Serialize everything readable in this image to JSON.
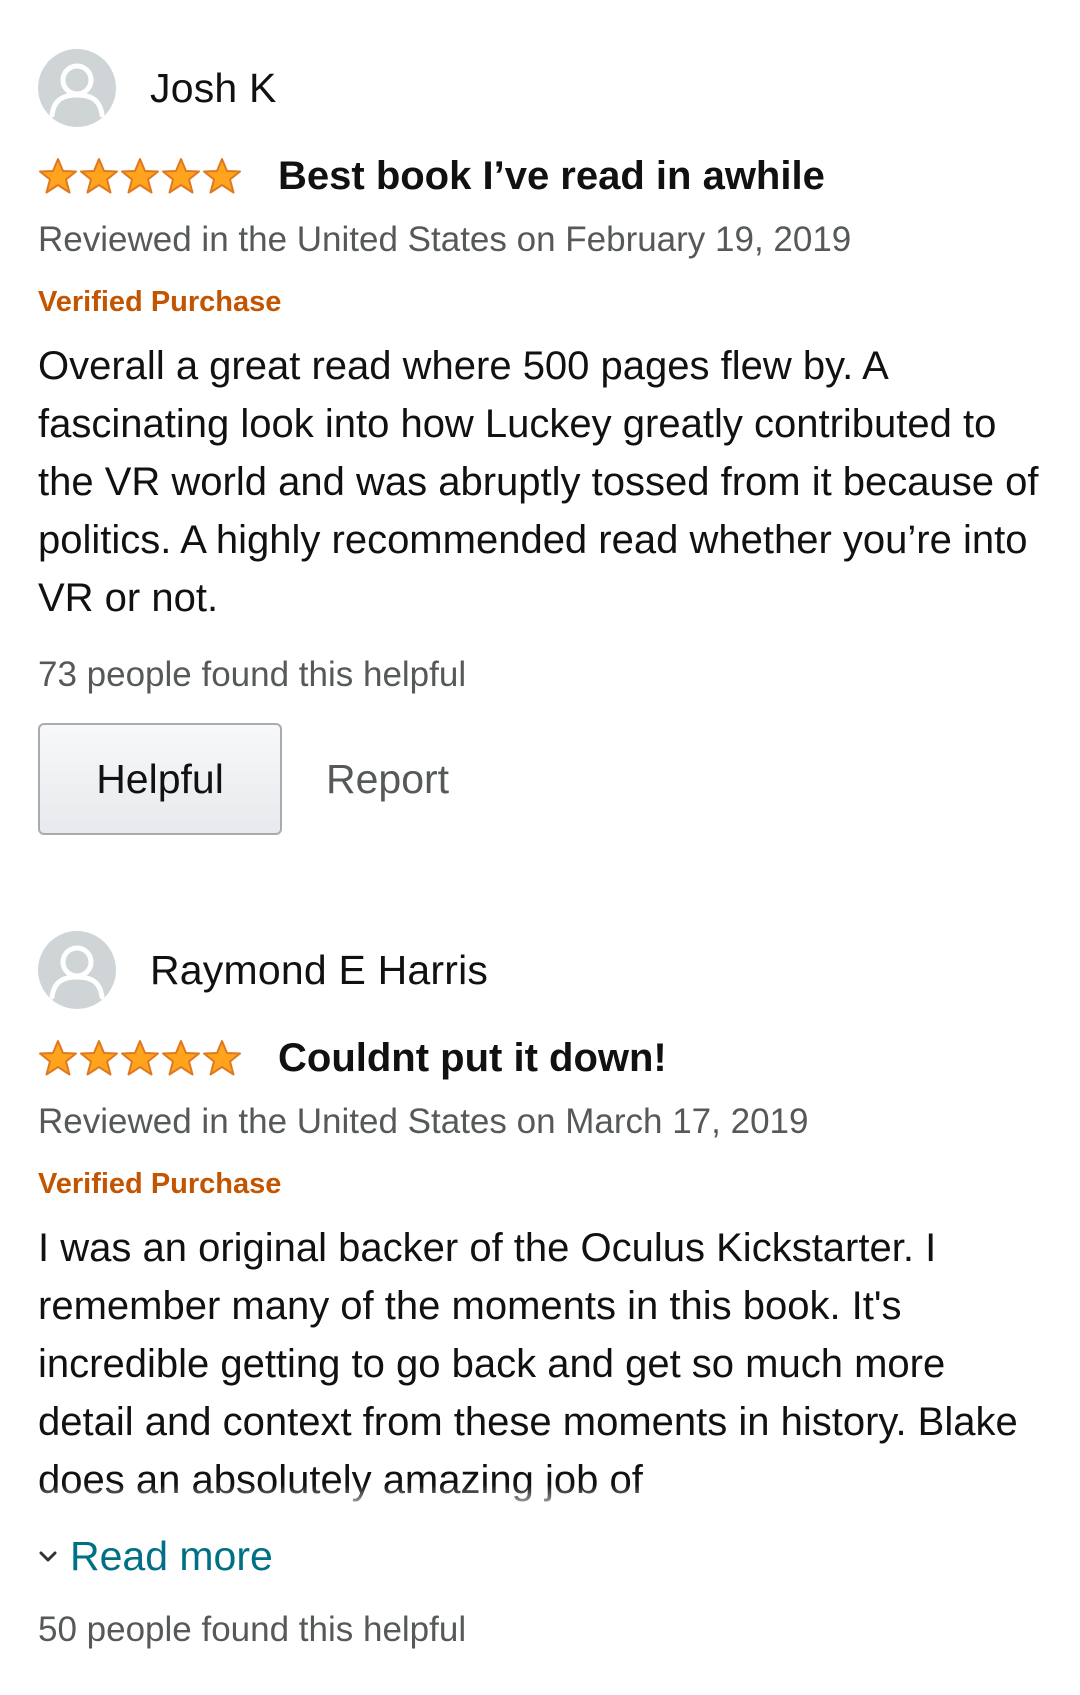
{
  "reviews": [
    {
      "reviewer": "Josh K",
      "rating": 5,
      "title": "Best book I’ve read in awhile",
      "date": "Reviewed in the United States on February 19, 2019",
      "verified": "Verified Purchase",
      "body": "Overall a great read where 500 pages flew by. A fascinating look into how Luckey greatly contributed to the VR world and was abruptly tossed from it because of politics. A highly recommended read whether you’re into VR or not.",
      "helpful_count": "73 people found this helpful",
      "helpful_label": "Helpful",
      "report_label": "Report"
    },
    {
      "reviewer": "Raymond E Harris",
      "rating": 5,
      "title": "Couldnt put it down!",
      "date": "Reviewed in the United States on March 17, 2019",
      "verified": "Verified Purchase",
      "body": "I was an original backer of the Oculus Kickstarter. I remember many of the moments in this book. It's incredible getting to go back and get so much more detail and context from these moments in history. Blake does an absolutely amazing job of",
      "read_more_label": "Read more",
      "helpful_count": "50 people found this helpful"
    }
  ],
  "icons": {
    "avatar": "user-silhouette",
    "star": "star-filled",
    "read_more": "chevron-down"
  },
  "colors": {
    "star": "#ffa41c",
    "verified": "#c45500",
    "link": "#007185",
    "secondary_text": "#565959"
  }
}
